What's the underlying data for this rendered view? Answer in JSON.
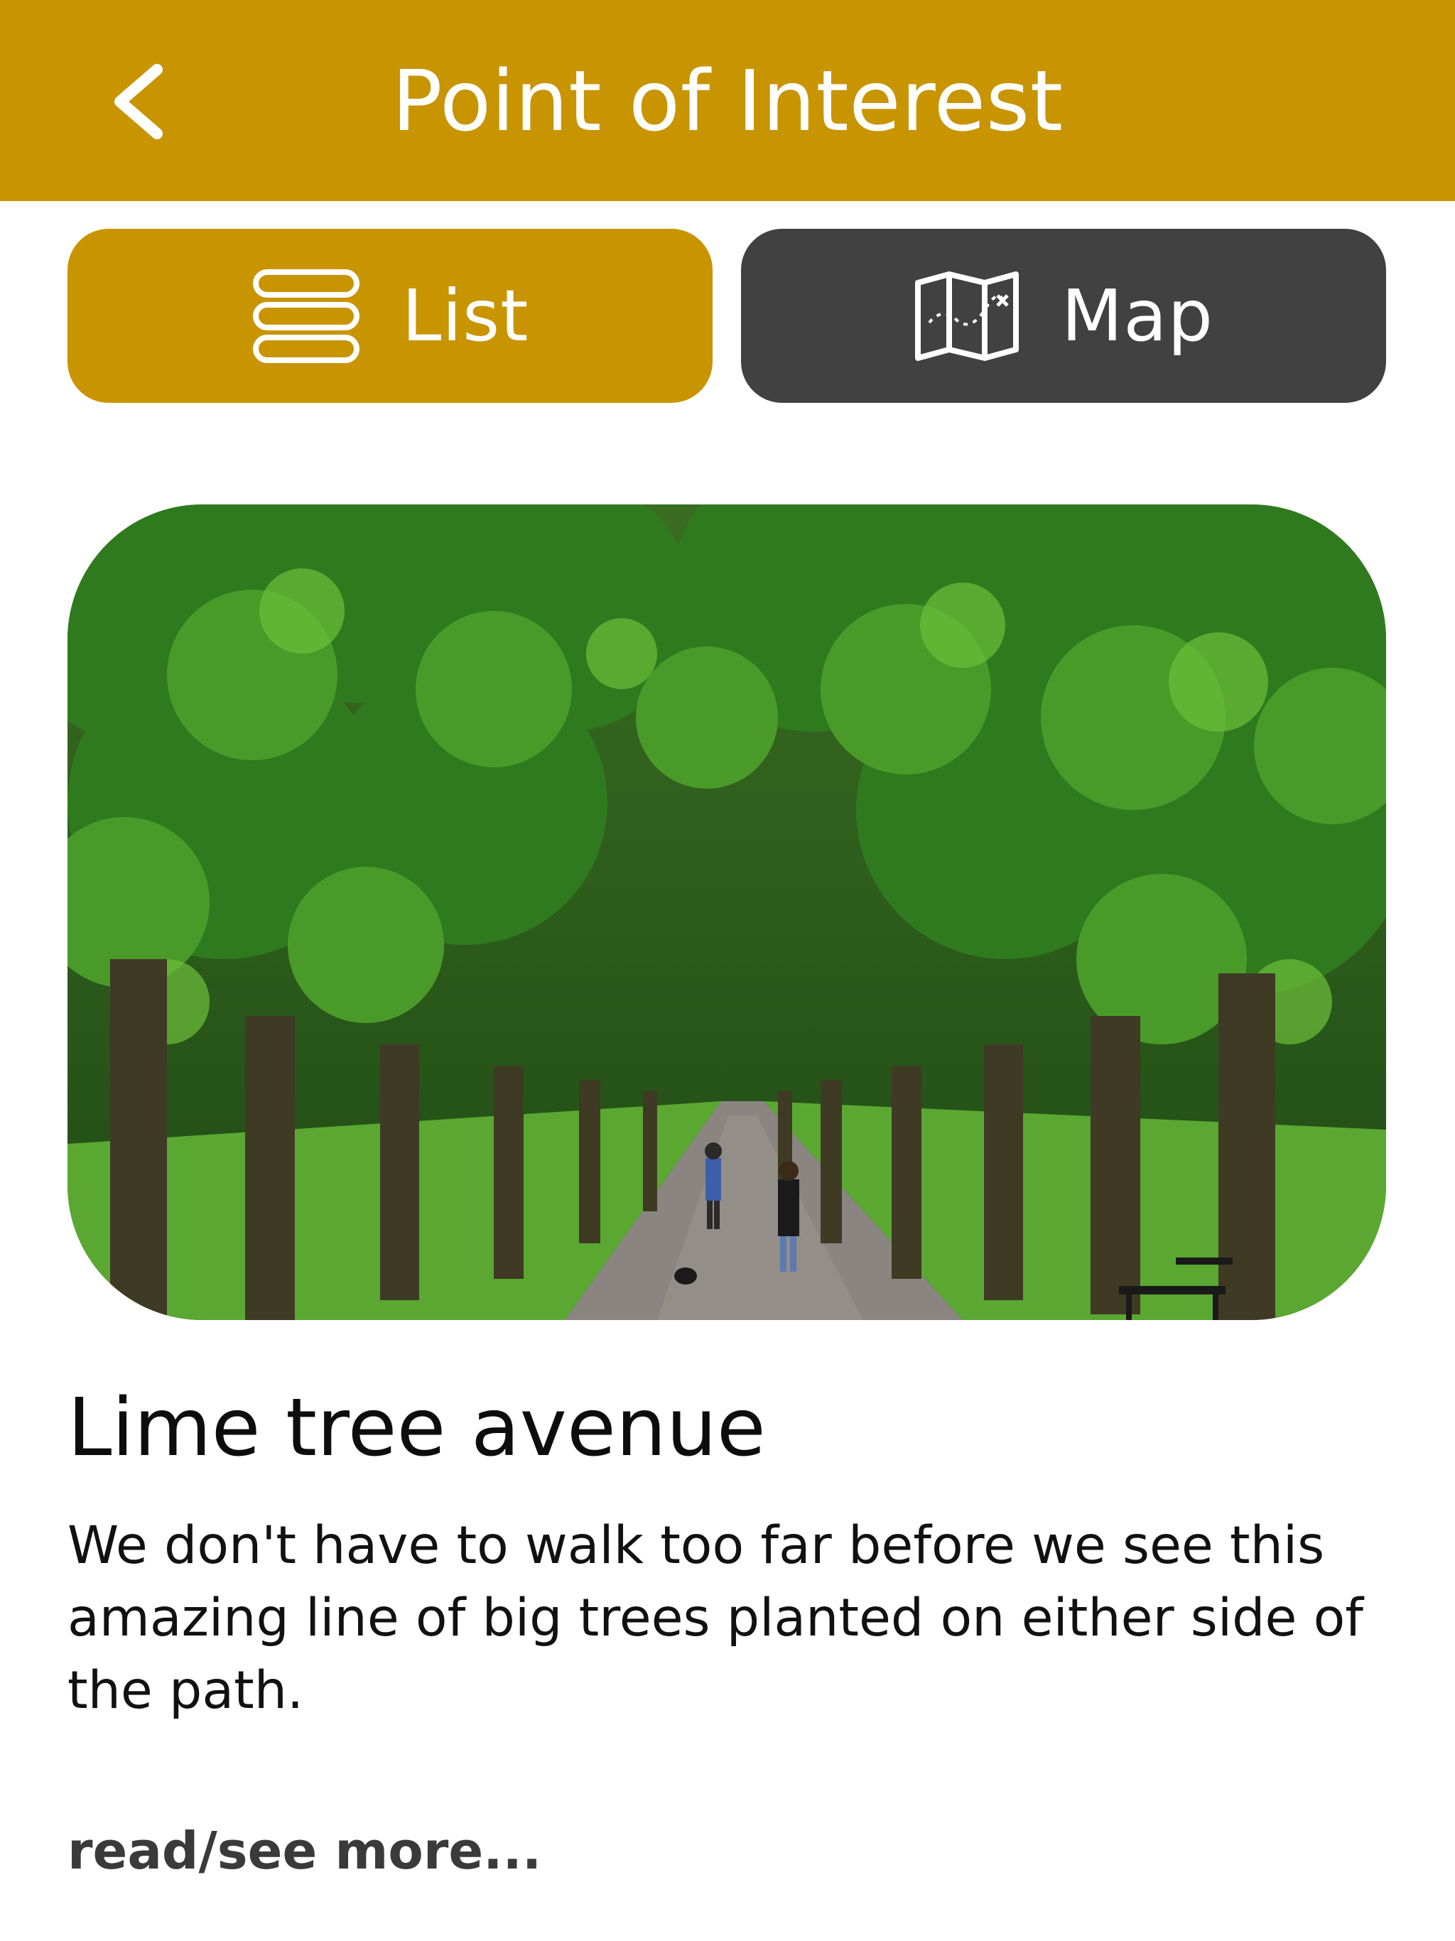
{
  "header": {
    "title": "Point of Interest",
    "back_icon": "chevron-left-icon",
    "background": "#c89400"
  },
  "view_toggle": {
    "list": {
      "label": "List",
      "icon": "list-icon",
      "active": true,
      "color": "#c89400"
    },
    "map": {
      "label": "Map",
      "icon": "folded-map-icon",
      "active": false,
      "color": "#414141"
    }
  },
  "point": {
    "title": "Lime tree avenue",
    "description": "We don't have to walk too far before we see this amazing line of big trees planted on either side of the path.",
    "read_more": "read/see more..."
  }
}
